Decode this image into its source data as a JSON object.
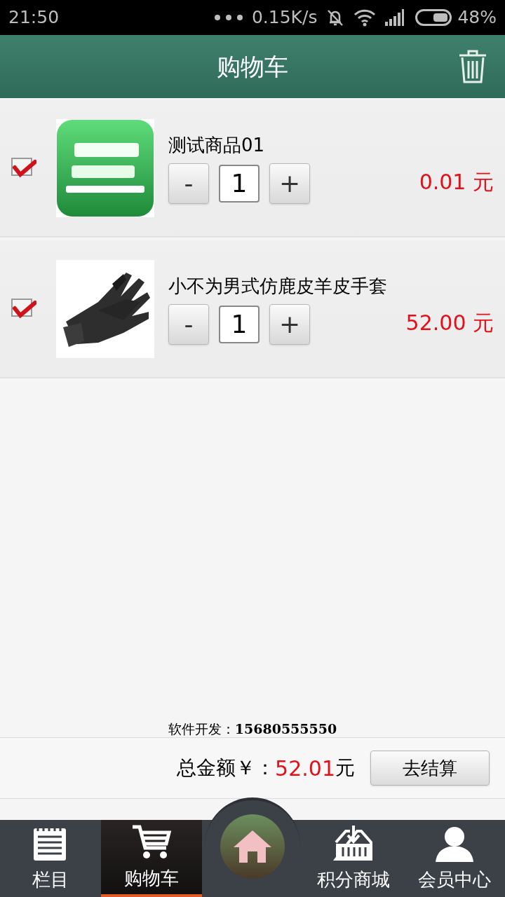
{
  "status_bar": {
    "time": "21:50",
    "speed": "0.15K/s",
    "battery": "48%"
  },
  "header": {
    "title": "购物车"
  },
  "cart_items": [
    {
      "checked": true,
      "name": "测试商品01",
      "quantity": "1",
      "minus": "-",
      "plus": "+",
      "price": "0.01 元",
      "image": {
        "kind": "logo"
      }
    },
    {
      "checked": true,
      "name": "小不为男式仿鹿皮羊皮手套",
      "quantity": "1",
      "minus": "-",
      "plus": "+",
      "price": "52.00 元",
      "image": {
        "kind": "glove"
      }
    }
  ],
  "developer_note": "软件开发：**15680555550**",
  "summary": {
    "total_label": "总金额￥：",
    "total": "52.01",
    "unit": "元",
    "checkout_button": "去结算"
  },
  "bottom_nav": [
    {
      "kind": "list",
      "label": "栏目",
      "selected": false
    },
    {
      "kind": "cart",
      "label": "购物车",
      "selected": true
    },
    {
      "kind": "home",
      "selected": false
    },
    {
      "kind": "download",
      "label": "积分商城",
      "selected": false
    },
    {
      "kind": "person",
      "label": "会员中心",
      "selected": false
    }
  ]
}
